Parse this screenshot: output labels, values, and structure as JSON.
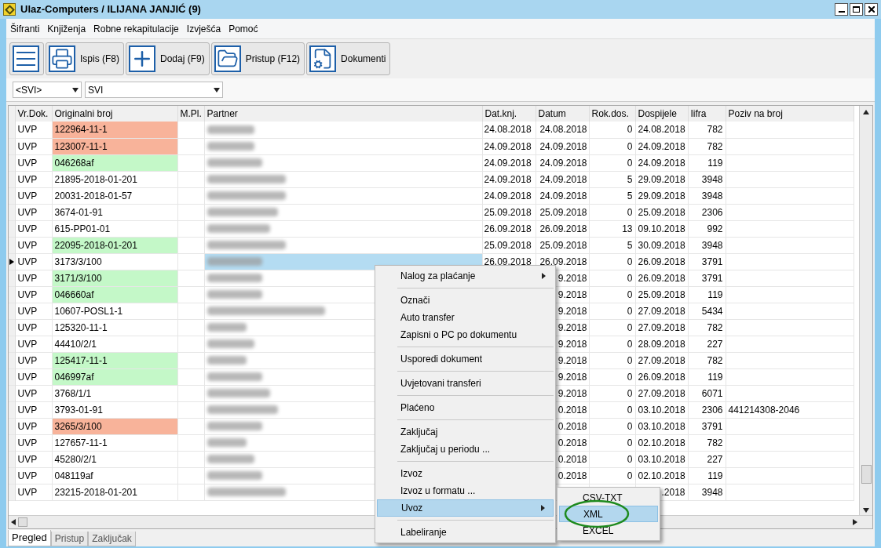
{
  "window": {
    "title": "Ulaz-Computers / ILIJANA JANJIĆ (9)"
  },
  "menu": [
    "Šifranti",
    "Knjiženja",
    "Robne rekapitulacije",
    "Izvješća",
    "Pomoć"
  ],
  "toolbar": [
    {
      "kind": "list"
    },
    {
      "kind": "print",
      "label": "Ispis (F8)"
    },
    {
      "kind": "add",
      "label": "Dodaj (F9)"
    },
    {
      "kind": "folder",
      "label": "Pristup (F12)"
    },
    {
      "kind": "docs",
      "label": "Dokumenti"
    }
  ],
  "filters": [
    "<SVI>",
    "SVI"
  ],
  "table": {
    "columns": [
      "Vr.Dok.",
      "Originalni broj",
      "M.Pl.",
      "Partner",
      "Dat.knj.",
      "Datum",
      "Rok.dos.",
      "Dospijele",
      "Iifra",
      "Poziv na broj"
    ],
    "rows": [
      {
        "selected": false,
        "vr": "UVP",
        "orig": "122964-11-1",
        "color": "#f8b39a",
        "datknj": "24.08.2018",
        "datum": "24.08.2018",
        "rok": "0",
        "dosp": "24.08.2018",
        "sifra": "782"
      },
      {
        "selected": false,
        "vr": "UVP",
        "orig": "123007-11-1",
        "color": "#f8b39a",
        "datknj": "24.09.2018",
        "datum": "24.09.2018",
        "rok": "0",
        "dosp": "24.09.2018",
        "sifra": "782"
      },
      {
        "selected": false,
        "vr": "UVP",
        "orig": "046268af",
        "color": "#c4f8c8",
        "datknj": "24.09.2018",
        "datum": "24.09.2018",
        "rok": "0",
        "dosp": "24.09.2018",
        "sifra": "119"
      },
      {
        "selected": false,
        "vr": "UVP",
        "orig": "21895-2018-01-201",
        "datknj": "24.09.2018",
        "datum": "24.09.2018",
        "rok": "5",
        "dosp": "29.09.2018",
        "sifra": "3948"
      },
      {
        "selected": false,
        "vr": "UVP",
        "orig": "20031-2018-01-57",
        "datknj": "24.09.2018",
        "datum": "24.09.2018",
        "rok": "5",
        "dosp": "29.09.2018",
        "sifra": "3948"
      },
      {
        "selected": false,
        "vr": "UVP",
        "orig": "3674-01-91",
        "datknj": "25.09.2018",
        "datum": "25.09.2018",
        "rok": "0",
        "dosp": "25.09.2018",
        "sifra": "2306"
      },
      {
        "selected": false,
        "vr": "UVP",
        "orig": "615-PP01-01",
        "datknj": "26.09.2018",
        "datum": "26.09.2018",
        "rok": "13",
        "dosp": "09.10.2018",
        "sifra": "992"
      },
      {
        "selected": false,
        "vr": "UVP",
        "orig": "22095-2018-01-201",
        "color": "#c4f8c8",
        "datknj": "25.09.2018",
        "datum": "25.09.2018",
        "rok": "5",
        "dosp": "30.09.2018",
        "sifra": "3948"
      },
      {
        "selected": true,
        "vr": "UVP",
        "orig": "3173/3/100",
        "datknj": "26.09.2018",
        "datum": "26.09.2018",
        "rok": "0",
        "dosp": "26.09.2018",
        "sifra": "3791"
      },
      {
        "selected": false,
        "vr": "UVP",
        "orig": "3171/3/100",
        "color": "#c4f8c8",
        "datum": "9.2018",
        "rok": "0",
        "dosp": "26.09.2018",
        "sifra": "3791"
      },
      {
        "selected": false,
        "vr": "UVP",
        "orig": "046660af",
        "color": "#c4f8c8",
        "datum": "9.2018",
        "rok": "0",
        "dosp": "25.09.2018",
        "sifra": "119"
      },
      {
        "selected": false,
        "vr": "UVP",
        "orig": "10607-POSL1-1",
        "datum": "9.2018",
        "rok": "0",
        "dosp": "27.09.2018",
        "sifra": "5434"
      },
      {
        "selected": false,
        "vr": "UVP",
        "orig": "125320-11-1",
        "datum": "9.2018",
        "rok": "0",
        "dosp": "27.09.2018",
        "sifra": "782"
      },
      {
        "selected": false,
        "vr": "UVP",
        "orig": "44410/2/1",
        "datum": "9.2018",
        "rok": "0",
        "dosp": "28.09.2018",
        "sifra": "227"
      },
      {
        "selected": false,
        "vr": "UVP",
        "orig": "125417-11-1",
        "color": "#c4f8c8",
        "datum": "9.2018",
        "rok": "0",
        "dosp": "27.09.2018",
        "sifra": "782"
      },
      {
        "selected": false,
        "vr": "UVP",
        "orig": "046997af",
        "color": "#c4f8c8",
        "datum": "9.2018",
        "rok": "0",
        "dosp": "26.09.2018",
        "sifra": "119"
      },
      {
        "selected": false,
        "vr": "UVP",
        "orig": "3768/1/1",
        "datum": "9.2018",
        "rok": "0",
        "dosp": "27.09.2018",
        "sifra": "6071"
      },
      {
        "selected": false,
        "vr": "UVP",
        "orig": "3793-01-91",
        "datum": "0.2018",
        "rok": "0",
        "dosp": "03.10.2018",
        "sifra": "2306",
        "poziv": "441214308-2046"
      },
      {
        "selected": false,
        "vr": "UVP",
        "orig": "3265/3/100",
        "color": "#f8b39a",
        "datum": "0.2018",
        "rok": "0",
        "dosp": "03.10.2018",
        "sifra": "3791"
      },
      {
        "selected": false,
        "vr": "UVP",
        "orig": "127657-11-1",
        "datum": "0.2018",
        "rok": "0",
        "dosp": "02.10.2018",
        "sifra": "782"
      },
      {
        "selected": false,
        "vr": "UVP",
        "orig": "45280/2/1",
        "datum": "0.2018",
        "rok": "0",
        "dosp": "03.10.2018",
        "sifra": "227"
      },
      {
        "selected": false,
        "vr": "UVP",
        "orig": "048119af",
        "datum": "0.2018",
        "rok": "0",
        "dosp": "02.10.2018",
        "sifra": "119"
      },
      {
        "selected": false,
        "vr": "UVP",
        "orig": "23215-2018-01-201",
        "dosp": ".2018",
        "sifra": "3948"
      }
    ]
  },
  "context_menu": [
    {
      "kind": "item",
      "label": "Nalog za plaćanje",
      "submenu": true,
      "selected": false
    },
    {
      "kind": "separator"
    },
    {
      "kind": "item",
      "label": "Označi",
      "selected": false
    },
    {
      "kind": "item",
      "label": "Auto transfer",
      "selected": false
    },
    {
      "kind": "item",
      "label": "Zapisni o PC po dokumentu",
      "selected": false
    },
    {
      "kind": "separator"
    },
    {
      "kind": "item",
      "label": "Usporedi dokument",
      "selected": false
    },
    {
      "kind": "separator"
    },
    {
      "kind": "item",
      "label": "Uvjetovani transferi",
      "selected": false
    },
    {
      "kind": "separator"
    },
    {
      "kind": "item",
      "label": "Plaćeno",
      "selected": false
    },
    {
      "kind": "separator"
    },
    {
      "kind": "item",
      "label": "Zaključaj",
      "selected": false
    },
    {
      "kind": "item",
      "label": "Zaključaj u periodu ...",
      "selected": false
    },
    {
      "kind": "separator"
    },
    {
      "kind": "item",
      "label": "Izvoz",
      "selected": false
    },
    {
      "kind": "item",
      "label": "Izvoz u formatu ...",
      "selected": false
    },
    {
      "kind": "item",
      "label": "Uvoz",
      "submenu": true,
      "selected": true
    },
    {
      "kind": "separator"
    },
    {
      "kind": "item",
      "label": "Labeliranje",
      "selected": false
    }
  ],
  "submenu": [
    {
      "label": "CSV-TXT",
      "selected": false
    },
    {
      "label": "XML",
      "selected": true,
      "circled": true
    },
    {
      "label": "EXCEL",
      "selected": false
    }
  ],
  "tabs": [
    {
      "label": "Pregled",
      "selected": true
    },
    {
      "label": "Pristup",
      "selected": false
    },
    {
      "label": "Zaključak",
      "selected": false
    }
  ]
}
